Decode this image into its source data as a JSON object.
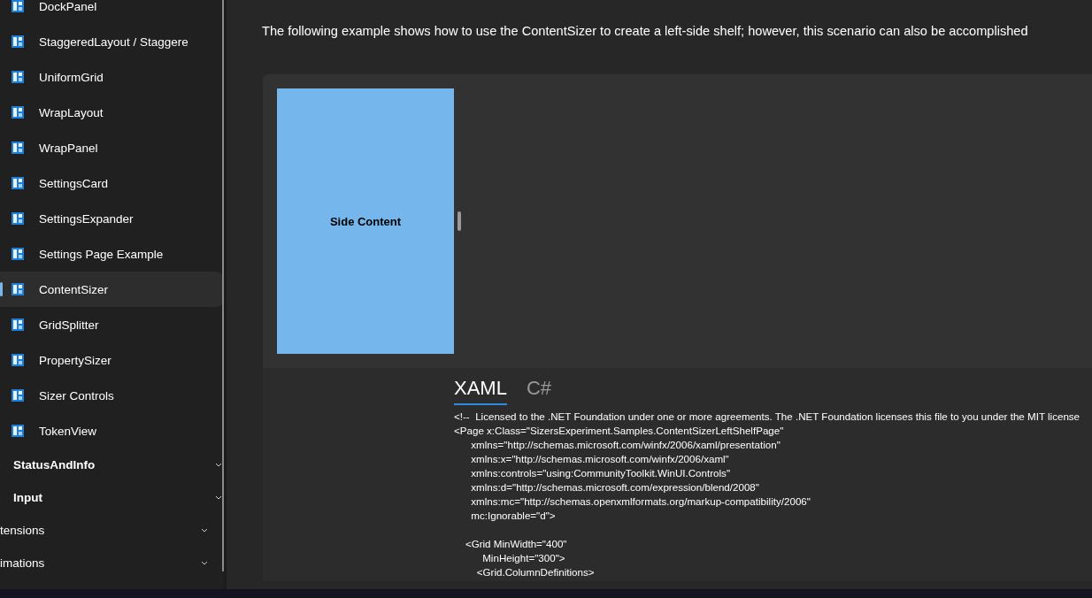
{
  "sidebar": {
    "items": [
      {
        "label": "DockPanel",
        "selected": false
      },
      {
        "label": "StaggeredLayout / Staggere",
        "selected": false
      },
      {
        "label": "UniformGrid",
        "selected": false
      },
      {
        "label": "WrapLayout",
        "selected": false
      },
      {
        "label": "WrapPanel",
        "selected": false
      },
      {
        "label": "SettingsCard",
        "selected": false
      },
      {
        "label": "SettingsExpander",
        "selected": false
      },
      {
        "label": "Settings Page Example",
        "selected": false
      },
      {
        "label": "ContentSizer",
        "selected": true
      },
      {
        "label": "GridSplitter",
        "selected": false
      },
      {
        "label": "PropertySizer",
        "selected": false
      },
      {
        "label": "Sizer Controls",
        "selected": false
      },
      {
        "label": "TokenView",
        "selected": false
      }
    ],
    "groups": [
      {
        "label": "StatusAndInfo",
        "kind": "sub",
        "expanded": false
      },
      {
        "label": "Input",
        "kind": "sub",
        "expanded": false
      },
      {
        "label": "tensions",
        "kind": "top",
        "expanded": false
      },
      {
        "label": "imations",
        "kind": "top",
        "expanded": false
      }
    ]
  },
  "description": "The following example shows how to use the ContentSizer to create a left-side shelf; however, this scenario can also be accomplished",
  "example": {
    "side_content": "Side Content"
  },
  "code": {
    "tabs": [
      {
        "label": "XAML",
        "selected": true
      },
      {
        "label": "C#",
        "selected": false
      }
    ],
    "text": "<!--  Licensed to the .NET Foundation under one or more agreements. The .NET Foundation licenses this file to you under the MIT license\n<Page x:Class=\"SizersExperiment.Samples.ContentSizerLeftShelfPage\"\n      xmlns=\"http://schemas.microsoft.com/winfx/2006/xaml/presentation\"\n      xmlns:x=\"http://schemas.microsoft.com/winfx/2006/xaml\"\n      xmlns:controls=\"using:CommunityToolkit.WinUI.Controls\"\n      xmlns:d=\"http://schemas.microsoft.com/expression/blend/2008\"\n      xmlns:mc=\"http://schemas.openxmlformats.org/markup-compatibility/2006\"\n      mc:Ignorable=\"d\">\n\n    <Grid MinWidth=\"400\"\n          MinHeight=\"300\">\n        <Grid.ColumnDefinitions>"
  }
}
